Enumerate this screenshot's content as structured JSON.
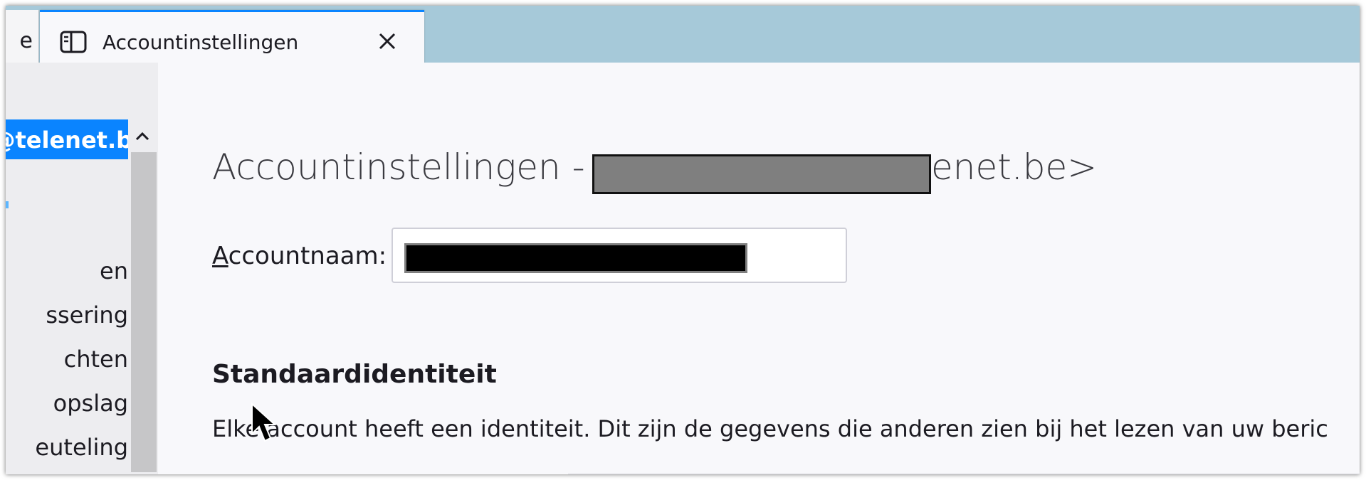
{
  "tabs": {
    "partial_label": "e",
    "active_title": "Accountinstellingen"
  },
  "sidebar": {
    "selected_account": "@telenet.b",
    "items": [
      {
        "label": "en"
      },
      {
        "label": "ssering"
      },
      {
        "label": "chten"
      },
      {
        "label": "opslag"
      },
      {
        "label": "euteling"
      }
    ]
  },
  "main": {
    "heading_prefix": "Accountinstellingen - <",
    "heading_suffix": "enet.be>",
    "account_name_label_first": "A",
    "account_name_label_rest": "ccountnaam:",
    "section_title": "Standaardidentiteit",
    "section_description": "Elke account heeft een identiteit. Dit zijn de gegevens die anderen zien bij het lezen van uw beric"
  },
  "colors": {
    "tabbar_bg": "#a6c9d9",
    "accent": "#0a84ff",
    "content_bg": "#f8f8fb",
    "sidebar_bg": "#ededf0"
  },
  "icons": {
    "tab_icon": "sidebar-layout-icon",
    "close": "close-icon",
    "scroll_up": "chevron-up-icon",
    "cursor": "mouse-pointer-icon"
  }
}
